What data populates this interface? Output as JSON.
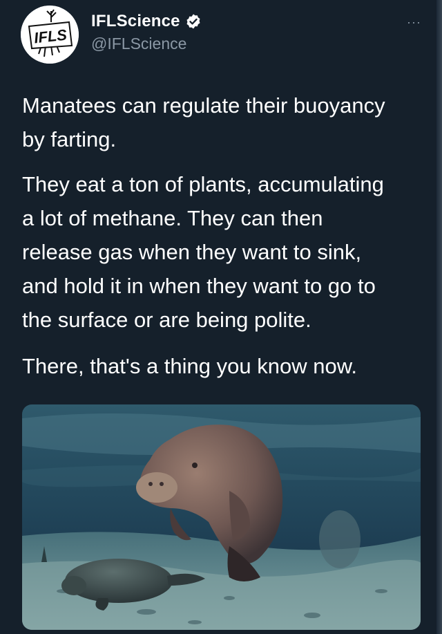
{
  "account": {
    "display_name": "IFLScience",
    "handle": "@IFLScience",
    "avatar_text": "IFLS",
    "verified": true
  },
  "menu": {
    "more_label": "···"
  },
  "tweet": {
    "paragraphs": [
      "Manatees can regulate their buoyancy\nby farting.",
      "They eat a ton of plants, accumulating\na lot of methane. They can then\nrelease gas when they want to sink,\nand hold it in when they want to go to\nthe surface or are being polite.",
      "There, that's a thing you know now."
    ]
  },
  "colors": {
    "background": "#15202b",
    "text": "#ffffff",
    "secondary_text": "#8b98a5",
    "verified_badge": "#ffffff"
  },
  "icons": {
    "verified": "verified-badge-icon",
    "more": "more-options-icon"
  }
}
